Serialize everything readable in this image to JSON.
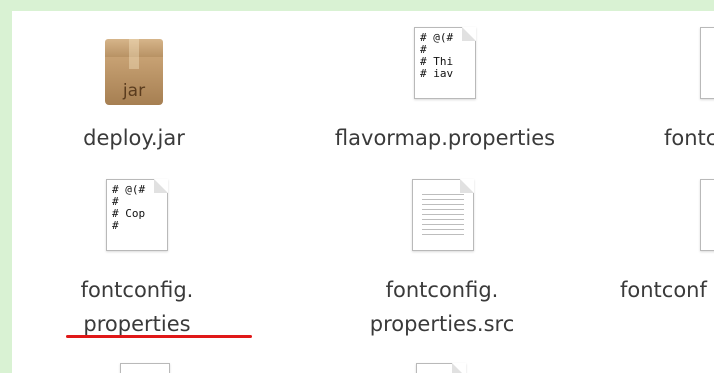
{
  "files": [
    {
      "name": "deploy.jar",
      "icon": "jar-icon",
      "badge": "jar"
    },
    {
      "name": "flavormap.properties",
      "icon": "properties-document-icon",
      "preview": "# @(#\n#\n# Thi\n# iav"
    },
    {
      "name": "fontc",
      "icon": "document-icon"
    },
    {
      "name_line1": "fontconfig.",
      "name_line2": "properties",
      "icon": "properties-document-icon",
      "preview": "# @(#\n#\n# Cop\n#"
    },
    {
      "name_line1": "fontconfig.",
      "name_line2": "properties.src",
      "icon": "text-document-icon"
    },
    {
      "name": "fontconf",
      "icon": "document-icon"
    }
  ],
  "highlight_color": "#e01818"
}
